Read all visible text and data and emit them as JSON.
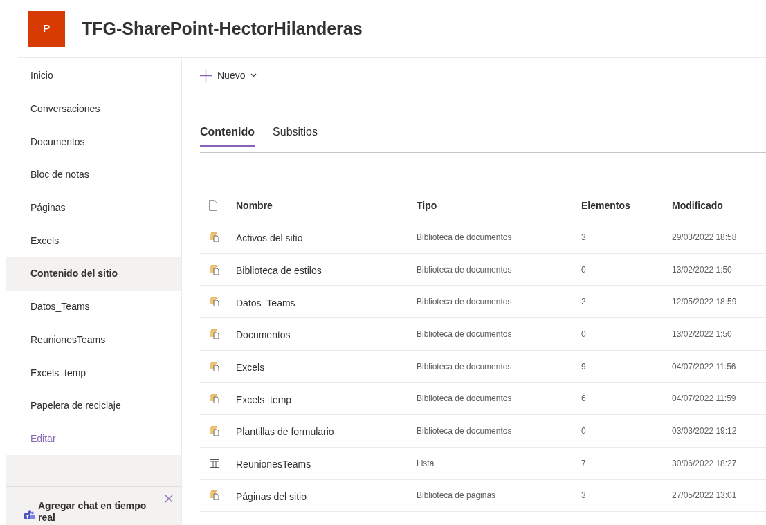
{
  "site": {
    "logo_letter": "P",
    "title": "TFG-SharePoint-HectorHilanderas"
  },
  "sidebar": {
    "items": [
      {
        "label": "Inicio",
        "selected": false
      },
      {
        "label": "Conversaciones",
        "selected": false
      },
      {
        "label": "Documentos",
        "selected": false
      },
      {
        "label": "Bloc de notas",
        "selected": false
      },
      {
        "label": "Páginas",
        "selected": false
      },
      {
        "label": "Excels",
        "selected": false
      },
      {
        "label": "Contenido del sitio",
        "selected": true
      },
      {
        "label": "Datos_Teams",
        "selected": false
      },
      {
        "label": "ReunionesTeams",
        "selected": false
      },
      {
        "label": "Excels_temp",
        "selected": false
      },
      {
        "label": "Papelera de reciclaje",
        "selected": false
      }
    ],
    "edit_link": "Editar",
    "chat_banner": "Agregar chat en tiempo real"
  },
  "toolbar": {
    "new_button": "Nuevo"
  },
  "tabs": [
    {
      "label": "Contenido",
      "selected": true
    },
    {
      "label": "Subsitios",
      "selected": false
    }
  ],
  "table": {
    "columns": [
      "Nombre",
      "Tipo",
      "Elementos",
      "Modificado"
    ],
    "rows": [
      {
        "kind": "library",
        "name": "Activos del sitio",
        "type": "Biblioteca de documentos",
        "items": "3",
        "modified": "29/03/2022 18:58"
      },
      {
        "kind": "library",
        "name": "Biblioteca de estilos",
        "type": "Biblioteca de documentos",
        "items": "0",
        "modified": "13/02/2022 1:50"
      },
      {
        "kind": "library",
        "name": "Datos_Teams",
        "type": "Biblioteca de documentos",
        "items": "2",
        "modified": "12/05/2022 18:59"
      },
      {
        "kind": "library",
        "name": "Documentos",
        "type": "Biblioteca de documentos",
        "items": "0",
        "modified": "13/02/2022 1:50"
      },
      {
        "kind": "library",
        "name": "Excels",
        "type": "Biblioteca de documentos",
        "items": "9",
        "modified": "04/07/2022 11:56"
      },
      {
        "kind": "library",
        "name": "Excels_temp",
        "type": "Biblioteca de documentos",
        "items": "6",
        "modified": "04/07/2022 11:59"
      },
      {
        "kind": "library",
        "name": "Plantillas de formulario",
        "type": "Biblioteca de documentos",
        "items": "0",
        "modified": "03/03/2022 19:12"
      },
      {
        "kind": "list",
        "name": "ReunionesTeams",
        "type": "Lista",
        "items": "7",
        "modified": "30/06/2022 18:27"
      },
      {
        "kind": "library",
        "name": "Páginas del sitio",
        "type": "Biblioteca de páginas",
        "items": "3",
        "modified": "27/05/2022 13:01"
      }
    ]
  }
}
